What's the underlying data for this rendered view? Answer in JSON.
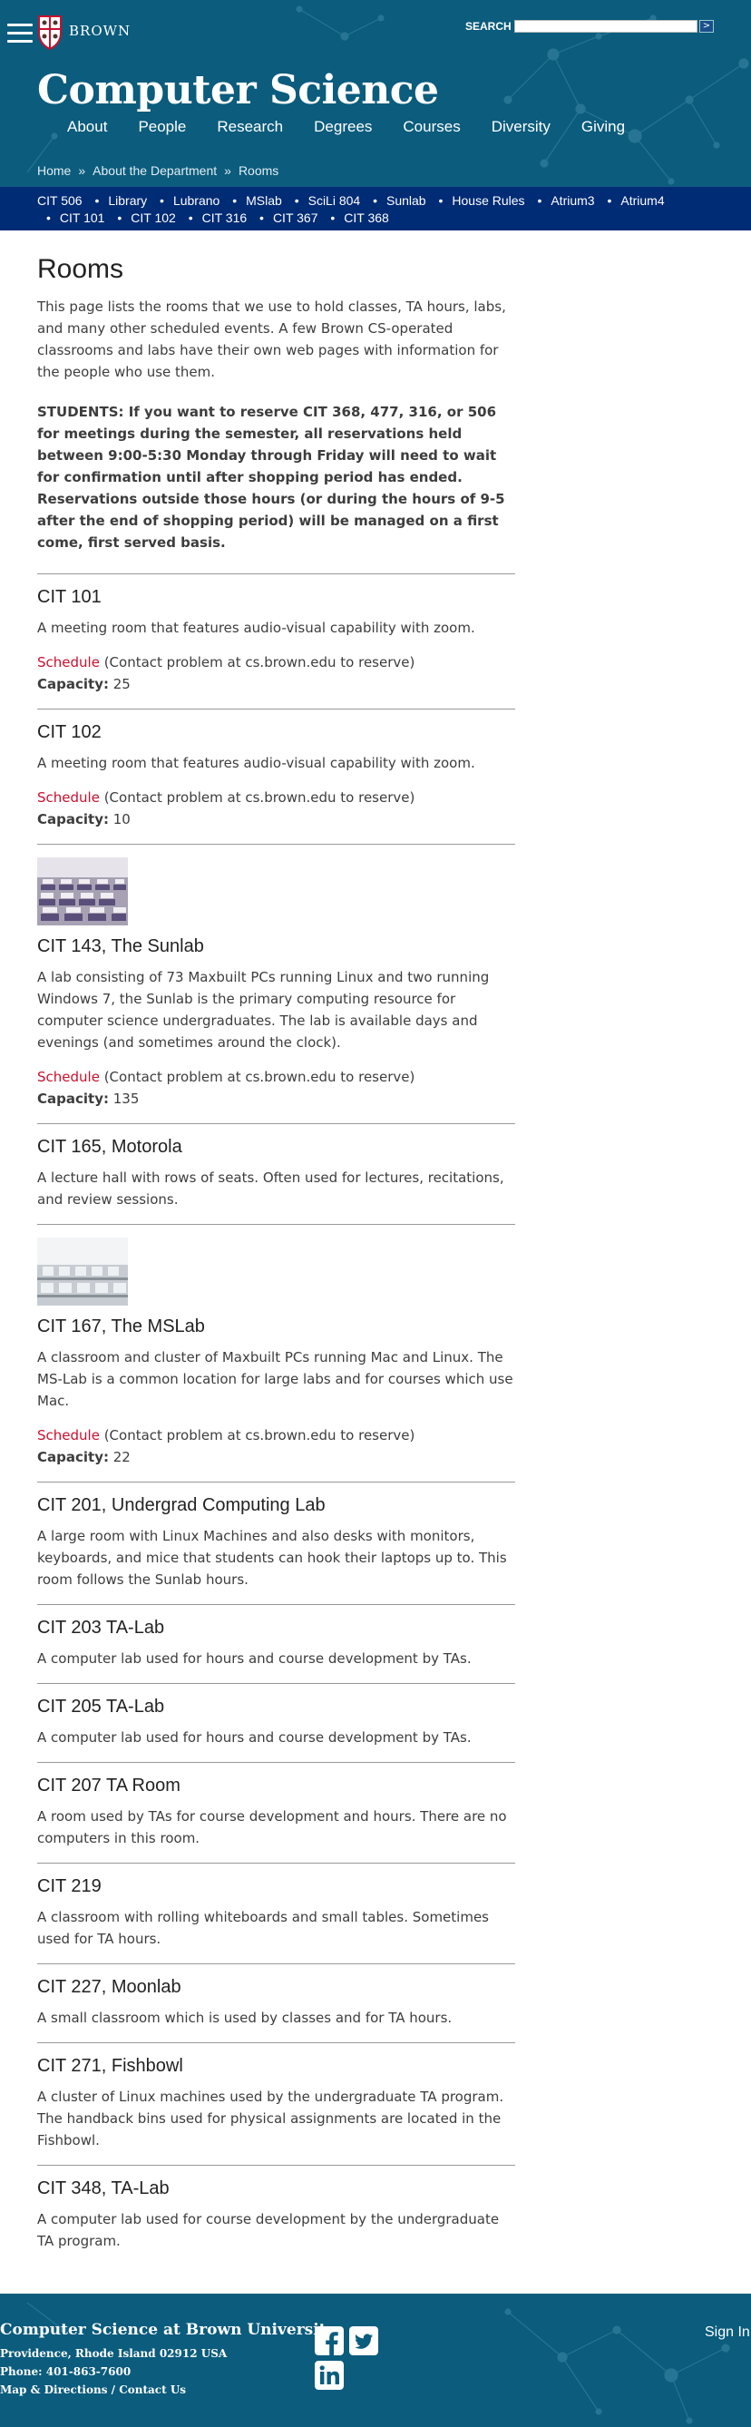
{
  "header": {
    "logo_text": "BROWN",
    "search_label": "SEARCH",
    "search_value": "",
    "search_button": ">",
    "site_title": "Computer Science",
    "nav": [
      "About",
      "People",
      "Research",
      "Degrees",
      "Courses",
      "Diversity",
      "Giving"
    ],
    "breadcrumb": [
      "Home",
      "About the Department",
      "Rooms"
    ],
    "breadcrumb_sep": "»"
  },
  "roombar": {
    "separator": "•",
    "links": [
      "CIT 506",
      "Library",
      "Lubrano",
      "MSlab",
      "SciLi 804",
      "Sunlab",
      "House Rules",
      "Atrium3",
      "Atrium4",
      "CIT 101",
      "CIT 102",
      "CIT 316",
      "CIT 367",
      "CIT 368"
    ]
  },
  "content": {
    "title": "Rooms",
    "intro": "This page lists the rooms that we use to hold classes, TA hours, labs, and many other scheduled events. A few Brown CS-operated classrooms and labs have their own web pages with information for the people who use them.",
    "notice": "STUDENTS: If you want to reserve CIT 368, 477, 316, or 506 for meetings during the semester, all reservations held between 9:00-5:30 Monday through Friday will need to wait for confirmation until after shopping period has ended. Reservations outside those hours (or during the hours of 9-5 after the end of shopping period) will be managed on a first come, first served basis.",
    "schedule_label": "Schedule",
    "schedule_note": " (Contact problem at cs.brown.edu to reserve)",
    "capacity_label": "Capacity:",
    "rooms": [
      {
        "name": "CIT 101",
        "desc": "A meeting room that features audio-visual capability with zoom.",
        "capacity": "25",
        "thumb": "",
        "has_schedule": true
      },
      {
        "name": "CIT 102",
        "desc": "A meeting room that features audio-visual capability with zoom.",
        "capacity": "10",
        "thumb": "",
        "has_schedule": true
      },
      {
        "name": "CIT 143, The Sunlab",
        "desc": "A lab consisting of 73 Maxbuilt PCs running Linux and two running Windows 7, the Sunlab is the primary computing resource for computer science undergraduates. The lab is available days and evenings (and sometimes around the clock).",
        "capacity": "135",
        "thumb": "sunlab-photo",
        "has_schedule": true
      },
      {
        "name": "CIT 165, Motorola",
        "desc": "A lecture hall with rows of seats. Often used for lectures, recitations, and review sessions.",
        "capacity": "",
        "thumb": "",
        "has_schedule": false
      },
      {
        "name": "CIT 167, The MSLab",
        "desc": "A classroom and cluster of Maxbuilt PCs running Mac and Linux. The MS-Lab is a common location for large labs and for courses which use Mac.",
        "capacity": "22",
        "thumb": "mslab-photo",
        "has_schedule": true
      },
      {
        "name": "CIT 201, Undergrad Computing Lab",
        "desc": "A large room with Linux Machines and also desks with monitors, keyboards, and mice that students can hook their laptops up to. This room follows the Sunlab hours.",
        "capacity": "",
        "thumb": "",
        "has_schedule": false
      },
      {
        "name": "CIT 203 TA-Lab",
        "desc": "A computer lab used for hours and course development by TAs.",
        "capacity": "",
        "thumb": "",
        "has_schedule": false
      },
      {
        "name": "CIT 205 TA-Lab",
        "desc": "A computer lab used for hours and course development by TAs.",
        "capacity": "",
        "thumb": "",
        "has_schedule": false
      },
      {
        "name": "CIT 207 TA Room",
        "desc": "A room used by TAs for course development and hours. There are no computers in this room.",
        "capacity": "",
        "thumb": "",
        "has_schedule": false
      },
      {
        "name": "CIT 219",
        "desc": "A classroom with rolling whiteboards and small tables. Sometimes used for TA hours.",
        "capacity": "",
        "thumb": "",
        "has_schedule": false
      },
      {
        "name": "CIT 227, Moonlab",
        "desc": "A small classroom which is used by classes and for TA hours.",
        "capacity": "",
        "thumb": "",
        "has_schedule": false
      },
      {
        "name": "CIT 271, Fishbowl",
        "desc": "A cluster of Linux machines used by the undergraduate TA program. The handback bins used for physical assignments are located in the Fishbowl.",
        "capacity": "",
        "thumb": "",
        "has_schedule": false
      },
      {
        "name": "CIT 348, TA-Lab",
        "desc": "A computer lab used for course development by the undergraduate TA program.",
        "capacity": "",
        "thumb": "",
        "has_schedule": false
      }
    ]
  },
  "footer": {
    "org": "Computer Science at Brown University",
    "address": "Providence, Rhode Island 02912 USA",
    "phone": "Phone: 401-863-7600",
    "link_map": "Map & Directions",
    "link_sep": " / ",
    "link_contact": "Contact Us",
    "signin": "Sign In",
    "social_icons": [
      "facebook-icon",
      "twitter-icon",
      "linkedin-icon"
    ]
  },
  "colors": {
    "header_bg": "#0b5c7d",
    "roombar_bg": "#002b75",
    "link_red": "#c8102e",
    "divider": "#999999"
  }
}
